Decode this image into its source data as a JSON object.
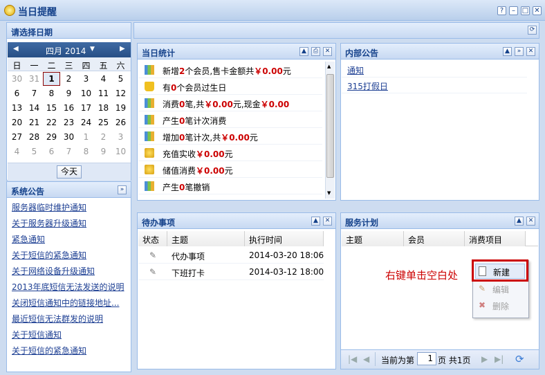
{
  "window": {
    "title": "当日提醒",
    "help": "?",
    "min": "–",
    "max": "□",
    "close": "✕"
  },
  "left": {
    "date_panel_title": "请选择日期",
    "calendar": {
      "month": "四月 2014",
      "dow": [
        "日",
        "一",
        "二",
        "三",
        "四",
        "五",
        "六"
      ],
      "weeks": [
        [
          "30",
          "31",
          "1",
          "2",
          "3",
          "4",
          "5"
        ],
        [
          "6",
          "7",
          "8",
          "9",
          "10",
          "11",
          "12"
        ],
        [
          "13",
          "14",
          "15",
          "16",
          "17",
          "18",
          "19"
        ],
        [
          "20",
          "21",
          "22",
          "23",
          "24",
          "25",
          "26"
        ],
        [
          "27",
          "28",
          "29",
          "30",
          "1",
          "2",
          "3"
        ],
        [
          "4",
          "5",
          "6",
          "7",
          "8",
          "9",
          "10"
        ]
      ],
      "today_label": "今天"
    },
    "notice_title": "系统公告",
    "notices": [
      "服务器临时维护通知",
      "关于服务器升级通知",
      "紧急通知",
      "关于短信的紧急通知",
      "关于网络设备升级通知",
      "2013年底短信无法发送的说明",
      "关闭短信通知中的链接地址...",
      "最近短信无法群发的说明",
      "关于短信通知",
      "关于短信的紧急通知"
    ]
  },
  "stats": {
    "title": "当日统计",
    "rows": [
      {
        "icon": "chart-icon",
        "parts": [
          "新增",
          "2",
          "个会员,售卡金额共",
          "￥0.00",
          "元"
        ]
      },
      {
        "icon": "crown-icon",
        "parts": [
          "有",
          "0",
          "个会员过生日",
          "",
          ""
        ]
      },
      {
        "icon": "chart-icon",
        "parts": [
          "消费",
          "0",
          "笔,共",
          "￥0.00",
          "元,现金"
        ],
        "extra": "￥0.00"
      },
      {
        "icon": "chart-icon",
        "parts": [
          "产生",
          "0",
          "笔计次消费",
          "",
          ""
        ]
      },
      {
        "icon": "chart-icon",
        "parts": [
          "增加",
          "0",
          "笔计次,共",
          "￥0.00",
          "元"
        ]
      },
      {
        "icon": "coin-icon",
        "parts": [
          "充值实收",
          "",
          "",
          "￥0.00",
          "元"
        ]
      },
      {
        "icon": "coin-icon",
        "parts": [
          "储值消费",
          "",
          "",
          "￥0.00",
          "元"
        ]
      },
      {
        "icon": "chart-icon",
        "parts": [
          "产生",
          "0",
          "笔撤销",
          "",
          ""
        ]
      }
    ]
  },
  "internal": {
    "title": "内部公告",
    "items": [
      "通知",
      "315打假日"
    ]
  },
  "todo": {
    "title": "待办事项",
    "headers": [
      "状态",
      "主题",
      "执行时间"
    ],
    "rows": [
      {
        "subject": "代办事项",
        "time": "2014-03-20 18:06"
      },
      {
        "subject": "下班打卡",
        "time": "2014-03-12 18:00"
      }
    ]
  },
  "plan": {
    "title": "服务计划",
    "headers": [
      "主题",
      "会员",
      "消费项目"
    ],
    "hint": "右键单击空白处",
    "menu": [
      "新建",
      "编辑",
      "删除"
    ],
    "pager": {
      "prefix": "当前为第",
      "page": "1",
      "suffix": "页 共1页"
    }
  },
  "colors": {
    "header_text": "#15428b",
    "border": "#99bbe8",
    "red": "#cc0000",
    "hint": "#cc0000"
  }
}
